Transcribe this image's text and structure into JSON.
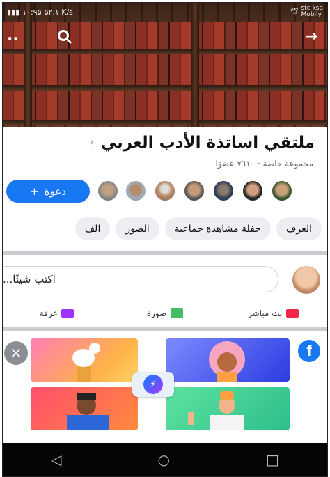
{
  "status_bar": {
    "left_text": "۱۰:۹۵",
    "speed": "۵۲.۱ K/s",
    "carrier_line1": "stc ksa",
    "carrier_line2": "Mobily"
  },
  "header": {
    "back_icon": "arrow-right-icon",
    "search_icon": "search-icon",
    "more_icon": "more-dots-icon"
  },
  "group": {
    "title": "ملتقي اساتذة الأدب العربي",
    "meta": "مجموعة خاصة · ٧٦١٠ عضوًا",
    "invite_label": "دعوة",
    "invite_plus": "+"
  },
  "chips": [
    "الغرف",
    "حفلة مشاهدة جماعية",
    "الصور",
    "الف"
  ],
  "composer": {
    "placeholder": "اكتب شيئًا..."
  },
  "actions": [
    {
      "label": "بث مباشر",
      "icon": "live-video-icon"
    },
    {
      "label": "صورة",
      "icon": "photo-icon"
    },
    {
      "label": "غرفة",
      "icon": "room-icon"
    }
  ],
  "promo": {
    "fb_letter": "f",
    "close_label": "×"
  },
  "colors": {
    "brand": "#1877f2",
    "live": "#f02849",
    "photo": "#45bd62",
    "room": "#a033ff"
  }
}
